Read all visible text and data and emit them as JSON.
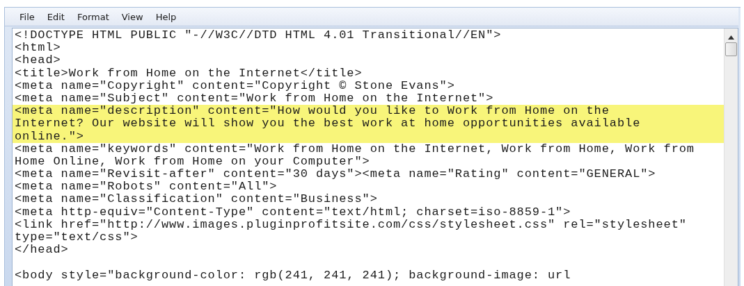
{
  "menu": [
    {
      "label": "File"
    },
    {
      "label": "Edit"
    },
    {
      "label": "Format"
    },
    {
      "label": "View"
    },
    {
      "label": "Help"
    }
  ],
  "lines": [
    {
      "text": "<!DOCTYPE HTML PUBLIC \"-//W3C//DTD HTML 4.01 Transitional//EN\">",
      "selected": false
    },
    {
      "text": "<html>",
      "selected": false
    },
    {
      "text": "<head>",
      "selected": false
    },
    {
      "text": "<title>Work from Home on the Internet</title>",
      "selected": false
    },
    {
      "text": "<meta name=\"Copyright\" content=\"Copyright © Stone Evans\">",
      "selected": false
    },
    {
      "text": "<meta name=\"Subject\" content=\"Work from Home on the Internet\">",
      "selected": false
    },
    {
      "text": "<meta name=\"description\" content=\"How would you like to Work from Home on the",
      "selected": true
    },
    {
      "text": "Internet? Our website will show you the best work at home opportunities available",
      "selected": true
    },
    {
      "text": "online.\">",
      "selected": true
    },
    {
      "text": "<meta name=\"keywords\" content=\"Work from Home on the Internet, Work from Home, Work from",
      "selected": false
    },
    {
      "text": "Home Online, Work from Home on your Computer\">",
      "selected": false
    },
    {
      "text": "<meta name=\"Revisit-after\" content=\"30 days\"><meta name=\"Rating\" content=\"GENERAL\">",
      "selected": false
    },
    {
      "text": "<meta name=\"Robots\" content=\"All\">",
      "selected": false
    },
    {
      "text": "<meta name=\"Classification\" content=\"Business\">",
      "selected": false
    },
    {
      "text": "<meta http-equiv=\"Content-Type\" content=\"text/html; charset=iso-8859-1\">",
      "selected": false
    },
    {
      "text": "<link href=\"http://www.images.pluginprofitsite.com/css/stylesheet.css\" rel=\"stylesheet\"",
      "selected": false
    },
    {
      "text": "type=\"text/css\">",
      "selected": false
    },
    {
      "text": "</head>",
      "selected": false
    },
    {
      "selected": false
    },
    {
      "text": "<body style=\"background-color: rgb(241, 241, 241); background-image: url",
      "selected": false
    }
  ]
}
